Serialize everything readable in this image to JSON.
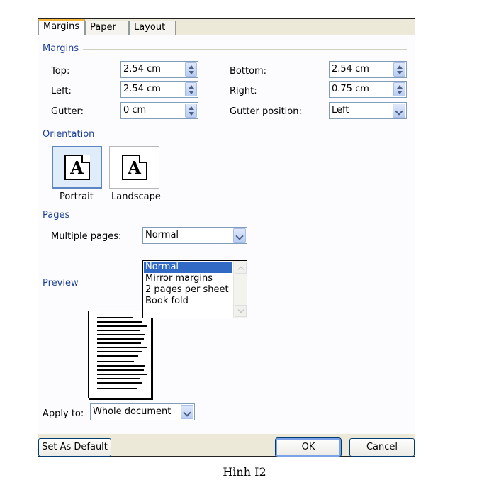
{
  "tabs": [
    {
      "label": "Margins",
      "active": true
    },
    {
      "label": "Paper",
      "active": false
    },
    {
      "label": "Layout",
      "active": false
    }
  ],
  "margins": {
    "title": "Margins",
    "top": {
      "label": "Top:",
      "value": "2.54 cm"
    },
    "bottom": {
      "label": "Bottom:",
      "value": "2.54 cm"
    },
    "left": {
      "label": "Left:",
      "value": "2.54 cm"
    },
    "right": {
      "label": "Right:",
      "value": "0.75 cm"
    },
    "gutter": {
      "label": "Gutter:",
      "value": "0 cm"
    },
    "gutter_position": {
      "label": "Gutter position:",
      "value": "Left"
    }
  },
  "orientation": {
    "title": "Orientation",
    "portrait": {
      "label": "Portrait",
      "glyph": "A",
      "selected": true
    },
    "landscape": {
      "label": "Landscape",
      "glyph": "A",
      "selected": false
    }
  },
  "pages": {
    "title": "Pages",
    "multiple_pages": {
      "label": "Multiple pages:",
      "value": "Normal",
      "options": [
        "Normal",
        "Mirror margins",
        "2 pages per sheet",
        "Book fold"
      ],
      "selected_index": 0
    }
  },
  "preview": {
    "title": "Preview"
  },
  "apply_to": {
    "label": "Apply to:",
    "value": "Whole document"
  },
  "buttons": {
    "set_default": "Set As Default",
    "ok": "OK",
    "cancel": "Cancel"
  },
  "caption": "Hình I2",
  "colors": {
    "section_title": "#1c3f95",
    "selection": "#316ac5",
    "tab_highlight": "#f5b73b"
  }
}
